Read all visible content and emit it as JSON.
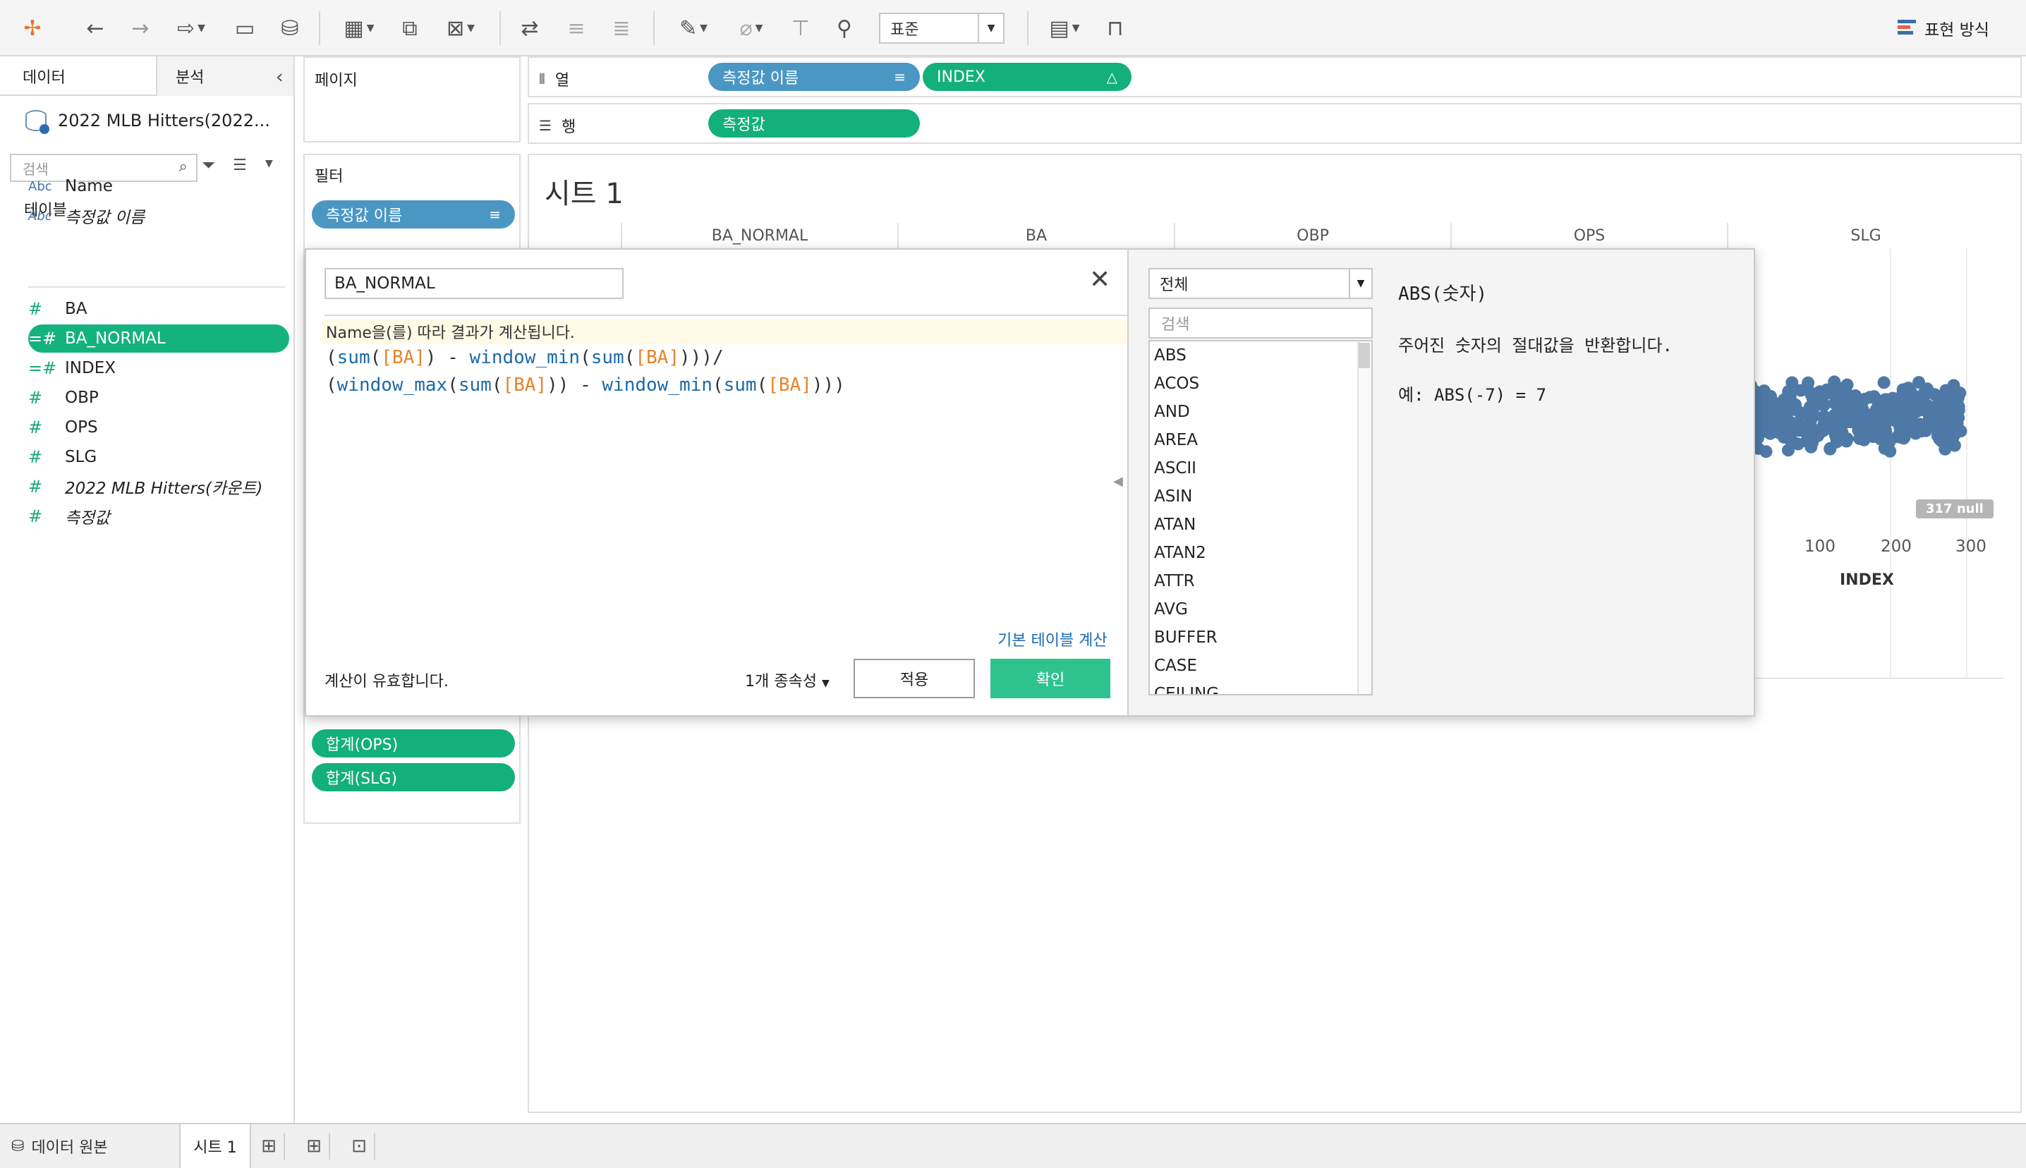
{
  "toolbar": {
    "standard_select": "표준",
    "show_me_label": "표현 방식"
  },
  "left_panel": {
    "tab_data": "데이터",
    "tab_analysis": "분석",
    "datasource": "2022 MLB Hitters(2022...",
    "search_placeholder": "검색",
    "tables_heading": "테이블",
    "fields": [
      {
        "type": "Abc",
        "name": "Name"
      },
      {
        "type": "Abc",
        "name": "측정값 이름"
      },
      {
        "type": "#",
        "name": "BA"
      },
      {
        "type": "=#",
        "name": "BA_NORMAL"
      },
      {
        "type": "=#",
        "name": "INDEX"
      },
      {
        "type": "#",
        "name": "OBP"
      },
      {
        "type": "#",
        "name": "OPS"
      },
      {
        "type": "#",
        "name": "SLG"
      },
      {
        "type": "#",
        "name": "2022 MLB Hitters(카운트)"
      },
      {
        "type": "#",
        "name": "측정값"
      }
    ]
  },
  "cards": {
    "pages": "페이지",
    "filters": "필터",
    "filter_pill": "측정값 이름",
    "measure_pills": [
      "합계(OPS)",
      "합계(SLG)"
    ]
  },
  "shelves": {
    "columns_label": "열",
    "rows_label": "행",
    "column_pills": [
      "측정값 이름",
      "INDEX"
    ],
    "row_pills": [
      "측정값"
    ]
  },
  "view": {
    "sheet_title": "시트 1",
    "column_headers": [
      "BA_NORMAL",
      "BA",
      "OBP",
      "OPS",
      "SLG"
    ],
    "x_ticks": [
      "100",
      "200",
      "300"
    ],
    "x_axis_title": "INDEX",
    "null_badge": "317 null"
  },
  "calc_dialog": {
    "name": "BA_NORMAL",
    "hint": "Name을(를) 따라 결과가 계산됩니다.",
    "code_line1": [
      {
        "t": "(",
        "c": ""
      },
      {
        "t": "sum",
        "c": "fn"
      },
      {
        "t": "(",
        "c": ""
      },
      {
        "t": "[BA]",
        "c": "fld"
      },
      {
        "t": ") - ",
        "c": ""
      },
      {
        "t": "window_min",
        "c": "fn"
      },
      {
        "t": "(",
        "c": ""
      },
      {
        "t": "sum",
        "c": "fn"
      },
      {
        "t": "(",
        "c": ""
      },
      {
        "t": "[BA]",
        "c": "fld"
      },
      {
        "t": ")))/",
        "c": ""
      }
    ],
    "code_line2": [
      {
        "t": "(",
        "c": ""
      },
      {
        "t": "window_max",
        "c": "fn"
      },
      {
        "t": "(",
        "c": ""
      },
      {
        "t": "sum",
        "c": "fn"
      },
      {
        "t": "(",
        "c": ""
      },
      {
        "t": "[BA]",
        "c": "fld"
      },
      {
        "t": ")) - ",
        "c": ""
      },
      {
        "t": "window_min",
        "c": "fn"
      },
      {
        "t": "(",
        "c": ""
      },
      {
        "t": "sum",
        "c": "fn"
      },
      {
        "t": "(",
        "c": ""
      },
      {
        "t": "[BA]",
        "c": "fld"
      },
      {
        "t": ")))",
        "c": ""
      }
    ],
    "link_basic_table": "기본 테이블 계산",
    "valid_message": "계산이 유효합니다.",
    "dependencies": "1개 종속성",
    "apply_label": "적용",
    "ok_label": "확인",
    "function_category": "전체",
    "function_search_placeholder": "검색",
    "functions": [
      "ABS",
      "ACOS",
      "AND",
      "AREA",
      "ASCII",
      "ASIN",
      "ATAN",
      "ATAN2",
      "ATTR",
      "AVG",
      "BUFFER",
      "CASE",
      "CEILING"
    ],
    "doc_title": "ABS(숫자)",
    "doc_description": "주어진 숫자의 절대값을 반환합니다.",
    "doc_example": "예: ABS(-7) = 7"
  },
  "bottom_bar": {
    "datasource_tab": "데이터 원본",
    "sheet_tab": "시트 1"
  },
  "colors": {
    "measure_green": "#13b07b",
    "dimension_blue": "#4b97c4",
    "mark_blue": "#4e79a7",
    "ok_button": "#2ec28f"
  }
}
